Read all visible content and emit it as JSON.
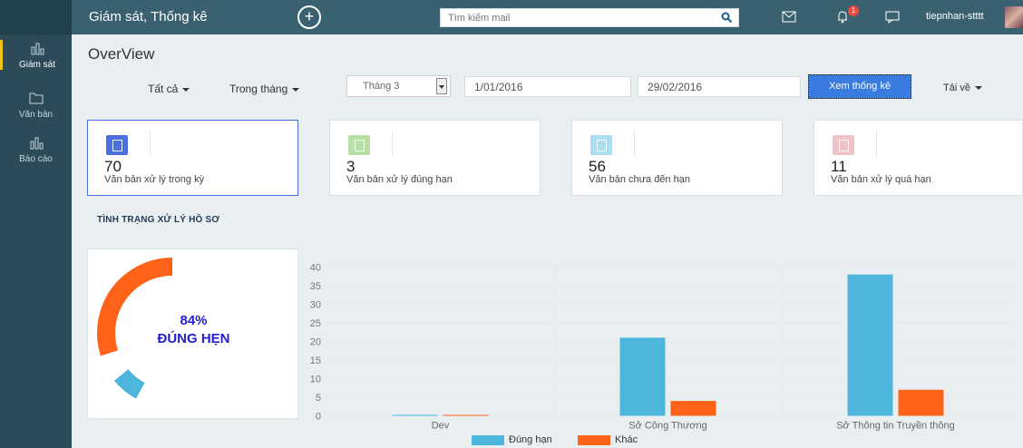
{
  "sidebar": {
    "items": [
      {
        "label": "Giám sát",
        "icon": "bar-chart-icon"
      },
      {
        "label": "Văn bản",
        "icon": "folder-icon"
      },
      {
        "label": "Báo cáo",
        "icon": "bar-chart-icon"
      }
    ]
  },
  "topbar": {
    "title": "Giám sát, Thống kê",
    "search_placeholder": "Tìm kiếm mail",
    "notification_count": "1",
    "username": "tiepnhan-stttt"
  },
  "page": {
    "title": "OverView",
    "filters": {
      "scope": "Tất cả",
      "period": "Trong tháng",
      "month": "Tháng 3",
      "from_date": "1/01/2016",
      "to_date": "29/02/2016",
      "view_button": "Xem thống kê",
      "download": "Tải về"
    }
  },
  "cards": [
    {
      "value": "70",
      "label": "Văn bản xử lý trong kỳ",
      "color": "#4a6fe0"
    },
    {
      "value": "3",
      "label": "Văn bản xử lý đúng hạn",
      "color": "#b9dfa8"
    },
    {
      "value": "56",
      "label": "Văn bản chưa đến hạn",
      "color": "#a9def0"
    },
    {
      "value": "11",
      "label": "Văn bản xử lý quá hạn",
      "color": "#efc3c8"
    }
  ],
  "section": {
    "title": "TÌNH TRẠNG XỬ LÝ HỒ SƠ"
  },
  "donut": {
    "percent_label": "84%",
    "status_label": "ĐÚNG HẸN",
    "segments": [
      {
        "value": 94,
        "color": "#ff6319"
      },
      {
        "value": 6,
        "color": "#4db6dd"
      }
    ]
  },
  "chart_data": {
    "type": "bar",
    "categories": [
      "Dev",
      "Sở Công Thương",
      "Sở Thông tin Truyền thông"
    ],
    "series": [
      {
        "name": "Đúng hạn",
        "color": "#4db6dd",
        "values": [
          0,
          21,
          38
        ]
      },
      {
        "name": "Khác",
        "color": "#ff6319",
        "values": [
          0,
          4,
          7
        ]
      }
    ],
    "ylim": [
      0,
      40
    ],
    "yticks": [
      "0",
      "5",
      "10",
      "15",
      "20",
      "25",
      "30",
      "35",
      "40"
    ],
    "grid": true,
    "legend": "bottom"
  }
}
